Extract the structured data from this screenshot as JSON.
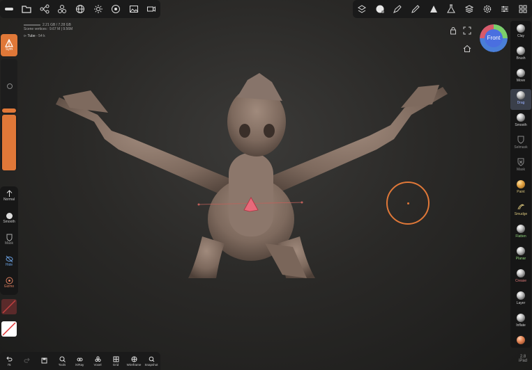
{
  "topbar_left": {
    "icons": [
      "pill-icon",
      "folder-icon",
      "scene-tree-icon",
      "spheres-icon",
      "globe-icon",
      "sun-icon",
      "settings-circle-icon",
      "image-icon",
      "video-icon"
    ]
  },
  "topbar_right": {
    "icons": [
      "layers-stack-icon",
      "material-ball-icon",
      "pen-icon",
      "pencil-icon",
      "triangle-icon",
      "flask-icon",
      "stack-icon",
      "gear-icon",
      "sliders-icon",
      "grid-icon"
    ]
  },
  "memory": {
    "line1": "2.21 GB / 7.28 GB",
    "line2": "Scene vertices : 9.67 M | 9.56M"
  },
  "object": {
    "name": "Tube",
    "detail": "- 54 k"
  },
  "left_panel": {
    "sym_label": "Sym",
    "tools": [
      {
        "label": "Normal",
        "icon": "arrow-up-icon"
      },
      {
        "label": "Smooth",
        "icon": "smooth-icon"
      },
      {
        "label": "Mask",
        "icon": "mask-icon"
      },
      {
        "label": "Hide",
        "icon": "hide-icon"
      },
      {
        "label": "Gizmo",
        "icon": "gizmo-icon"
      }
    ]
  },
  "right_tools": [
    {
      "label": "Clay",
      "color": "#cfcfcf"
    },
    {
      "label": "Brush",
      "color": "#cfcfcf"
    },
    {
      "label": "Move",
      "color": "#cfcfcf"
    },
    {
      "label": "Drag",
      "color": "#9ab0ff"
    },
    {
      "label": "Smooth",
      "color": "#cfcfcf"
    },
    {
      "label": "Selmask",
      "color": "#8e8e8e"
    },
    {
      "label": "Mask",
      "color": "#8e8e8e"
    },
    {
      "label": "Paint",
      "color": "#d6c27a"
    },
    {
      "label": "Smudge",
      "color": "#d6c27a"
    },
    {
      "label": "Flatten",
      "color": "#8fd27a"
    },
    {
      "label": "Planar",
      "color": "#8fd27a"
    },
    {
      "label": "Crease",
      "color": "#e07a7a"
    },
    {
      "label": "Layer",
      "color": "#cfcfcf"
    },
    {
      "label": "Inflate",
      "color": "#cfcfcf"
    }
  ],
  "bottom_bar": [
    {
      "label": "",
      "icon": "undo-icon"
    },
    {
      "label": "",
      "icon": "redo-icon"
    },
    {
      "label": "",
      "icon": "save-icon"
    },
    {
      "label": "Tools",
      "icon": "tools-icon"
    },
    {
      "label": "XrRay",
      "icon": "xray-icon"
    },
    {
      "label": "Voxel",
      "icon": "voxel-icon"
    },
    {
      "label": "Grid",
      "icon": "grid-icon"
    },
    {
      "label": "Wireframe",
      "icon": "wireframe-icon"
    },
    {
      "label": "Snapshot",
      "icon": "snapshot-icon"
    }
  ],
  "undo_count": "75",
  "gizmo_label": "Front",
  "version": {
    "number": "2.8",
    "device": "iPad"
  },
  "accent_color": "#e07838"
}
